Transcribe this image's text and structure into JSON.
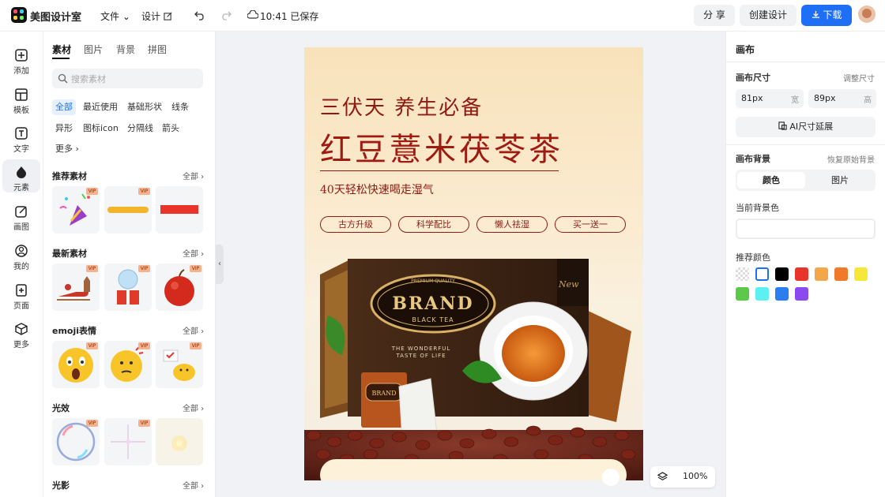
{
  "app": {
    "name": "美图设计室"
  },
  "topbar": {
    "file_menu": "文件",
    "design_menu": "设计",
    "save_status": "10:41 已保存",
    "share": "分 享",
    "create": "创建设计",
    "download": "下载"
  },
  "nav": [
    {
      "label": "添加",
      "icon": "plus-square-icon"
    },
    {
      "label": "模板",
      "icon": "template-icon"
    },
    {
      "label": "文字",
      "icon": "text-icon"
    },
    {
      "label": "元素",
      "icon": "shapes-icon"
    },
    {
      "label": "画图",
      "icon": "pen-icon"
    },
    {
      "label": "我的",
      "icon": "user-icon"
    },
    {
      "label": "页面",
      "icon": "page-add-icon"
    },
    {
      "label": "更多",
      "icon": "cube-icon"
    }
  ],
  "panel": {
    "tabs": [
      "素材",
      "图片",
      "背景",
      "拼图"
    ],
    "search_placeholder": "搜索素材",
    "chips": [
      "全部",
      "最近使用",
      "基础形状",
      "线条",
      "异形",
      "图标icon",
      "分隔线",
      "箭头",
      "更多"
    ],
    "sections": [
      {
        "title": "推荐素材",
        "more": "全部",
        "thumbs": [
          "confetti-popper",
          "yellow-stroke",
          "red-bar"
        ]
      },
      {
        "title": "最新素材",
        "more": "全部",
        "thumbs": [
          "sleigh",
          "snow-globe-gift",
          "apple"
        ]
      },
      {
        "title": "emoji表情",
        "more": "全部",
        "thumbs": [
          "shocked-emoji",
          "thinking-emoji",
          "duck-emoji"
        ]
      },
      {
        "title": "光效",
        "more": "全部",
        "thumbs": [
          "bubble",
          "sparkle",
          "glow"
        ]
      },
      {
        "title": "光影",
        "more": "全部",
        "thumbs": []
      }
    ],
    "vip": "VIP"
  },
  "poster": {
    "title1": "三伏天 养生必备",
    "title2": "红豆薏米茯苓茶",
    "subtitle": "40天轻松快速喝走湿气",
    "tags": [
      "古方升级",
      "科学配比",
      "懒人祛湿",
      "买一送一"
    ],
    "box": {
      "brand": "BRAND",
      "sub": "BLACK TEA",
      "quality": "PREMIUM QUALITY",
      "tagline1": "THE WONDERFUL",
      "tagline2": "TASTE OF LIFE",
      "badge": "New",
      "small_brand": "BRAND"
    }
  },
  "zoom": "100%",
  "right": {
    "title": "画布",
    "size_label": "画布尺寸",
    "size_link": "调整尺寸",
    "width_value": "81px",
    "width_unit": "宽",
    "height_value": "89px",
    "height_unit": "高",
    "ai_extend": "AI尺寸延展",
    "bg_label": "画布背景",
    "bg_reset": "恢复原始背景",
    "seg_color": "颜色",
    "seg_image": "图片",
    "current_bg": "当前背景色",
    "recommended": "推荐颜色",
    "swatches": [
      "transparent",
      "#ffffff",
      "#000000",
      "#e8342a",
      "#f2a84a",
      "#f07a2a",
      "#f5e83a",
      "#5cc94a",
      "#5cf0f0",
      "#2a7ef0",
      "#8a4af0"
    ]
  }
}
